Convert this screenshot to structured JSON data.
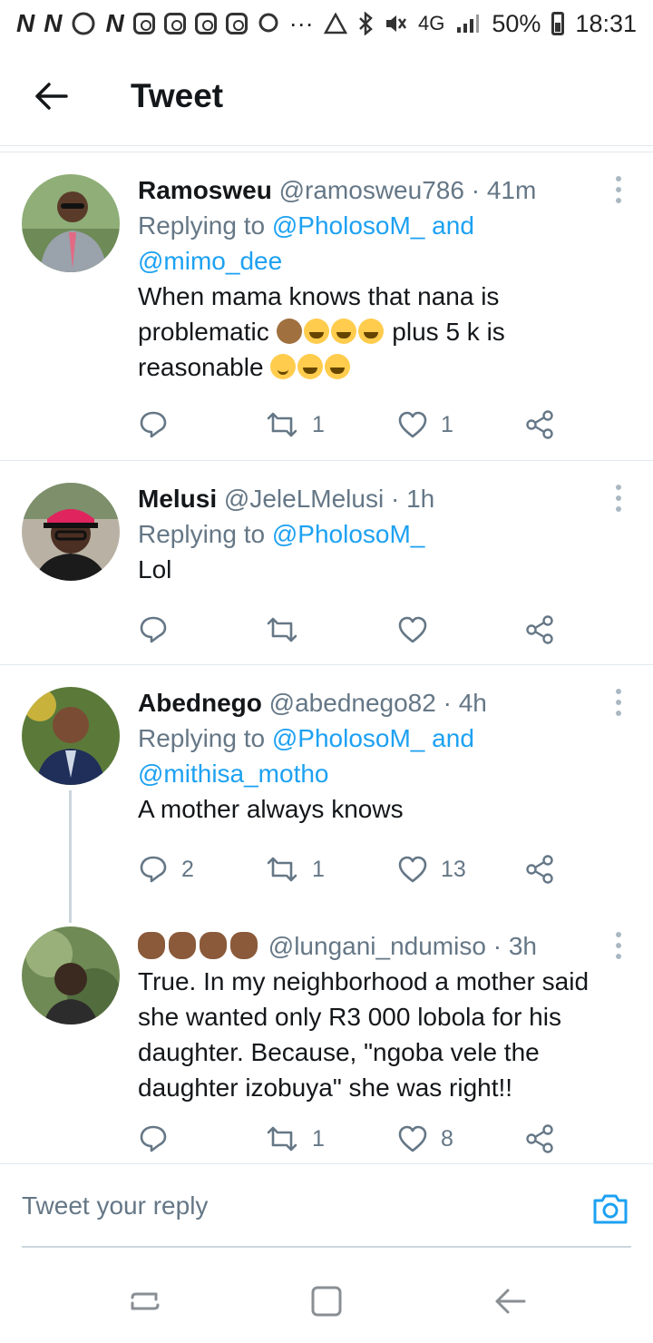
{
  "status_bar": {
    "left_glyphs": [
      "N",
      "N",
      "N"
    ],
    "network": "4G",
    "battery": "50%",
    "time": "18:31"
  },
  "header": {
    "title": "Tweet",
    "back_icon": "arrow-left-icon"
  },
  "tweets": [
    {
      "name": "Ramosweu",
      "handle": "@ramosweu786",
      "time": "41m",
      "reply_prefix": "Replying to ",
      "mention1": "@PholosoM_",
      "reply_and": " and",
      "mention2": "@mimo_dee",
      "text1": "When mama knows that nana is",
      "text2a": "problematic ",
      "text2b": " plus 5 k is",
      "text3": "reasonable ",
      "retweets": "1",
      "likes": "1",
      "replies": ""
    },
    {
      "name": "Melusi",
      "handle": "@JeleLMelusi",
      "time": "1h",
      "reply_prefix": "Replying to ",
      "mention1": "@PholosoM_",
      "text1": "Lol",
      "retweets": "",
      "likes": "",
      "replies": ""
    },
    {
      "name": "Abednego",
      "handle": "@abednego82",
      "time": "4h",
      "reply_prefix": "Replying to ",
      "mention1": "@PholosoM_",
      "reply_and": " and",
      "mention2": "@mithisa_motho",
      "text1": "A mother always knows",
      "replies": "2",
      "retweets": "1",
      "likes": "13"
    },
    {
      "name_emoji": "clapping-hands-emoji",
      "handle": "@lungani_ndumiso",
      "time": "3h",
      "text1": "True. In my neighborhood a mother said",
      "text2": "she wanted only R3 000 lobola for his",
      "text3": "daughter. Because, \"ngoba vele the",
      "text4": "daughter izobuya\" she was right!!",
      "replies": "",
      "retweets": "1",
      "likes": "8"
    }
  ],
  "meta_sep": " · ",
  "composer": {
    "placeholder": "Tweet your reply",
    "icon": "camera-icon"
  },
  "colors": {
    "accent": "#1da1f2",
    "secondary_text": "#657786",
    "divider": "#e1e8ed"
  }
}
